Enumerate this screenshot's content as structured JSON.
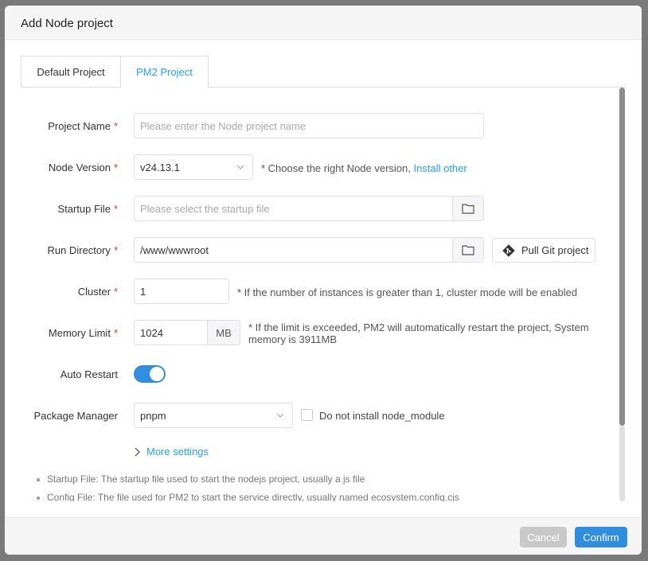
{
  "dialog": {
    "title": "Add Node project"
  },
  "tabs": [
    {
      "label": "Default Project"
    },
    {
      "label": "PM2 Project"
    }
  ],
  "form": {
    "project_name": {
      "label": "Project Name",
      "placeholder": "Please enter the Node project name",
      "value": ""
    },
    "node_version": {
      "label": "Node Version",
      "value": "v24.13.1",
      "hint": "* Choose the right Node version,",
      "hint_link": "Install other"
    },
    "startup_file": {
      "label": "Startup File",
      "placeholder": "Please select the startup file",
      "value": ""
    },
    "run_directory": {
      "label": "Run Directory",
      "value": "/www/wwwroot",
      "git_button": "Pull Git project"
    },
    "cluster": {
      "label": "Cluster",
      "value": "1",
      "hint": "* If the number of instances is greater than 1, cluster mode will be enabled"
    },
    "memory_limit": {
      "label": "Memory Limit",
      "value": "1024",
      "unit": "MB",
      "hint_line1": "* If the limit is exceeded, PM2 will automatically restart the project, System",
      "hint_line2": "memory is 3911MB"
    },
    "auto_restart": {
      "label": "Auto Restart",
      "enabled": true
    },
    "package_manager": {
      "label": "Package Manager",
      "value": "pnpm",
      "checkbox_label": "Do not install node_module",
      "checked": false
    },
    "more_settings": "More settings",
    "required_mark": "*"
  },
  "notes": [
    "Startup File: The startup file used to start the nodejs project, usually a js file",
    "Config File: The file used for PM2 to start the service directly, usually named ecosystem.config.cjs"
  ],
  "footer": {
    "cancel_label": "Cancel",
    "confirm_label": "Confirm"
  },
  "colors": {
    "accent": "#20a0ff",
    "primary_button": "#2f8ee0",
    "required": "#e53935"
  }
}
